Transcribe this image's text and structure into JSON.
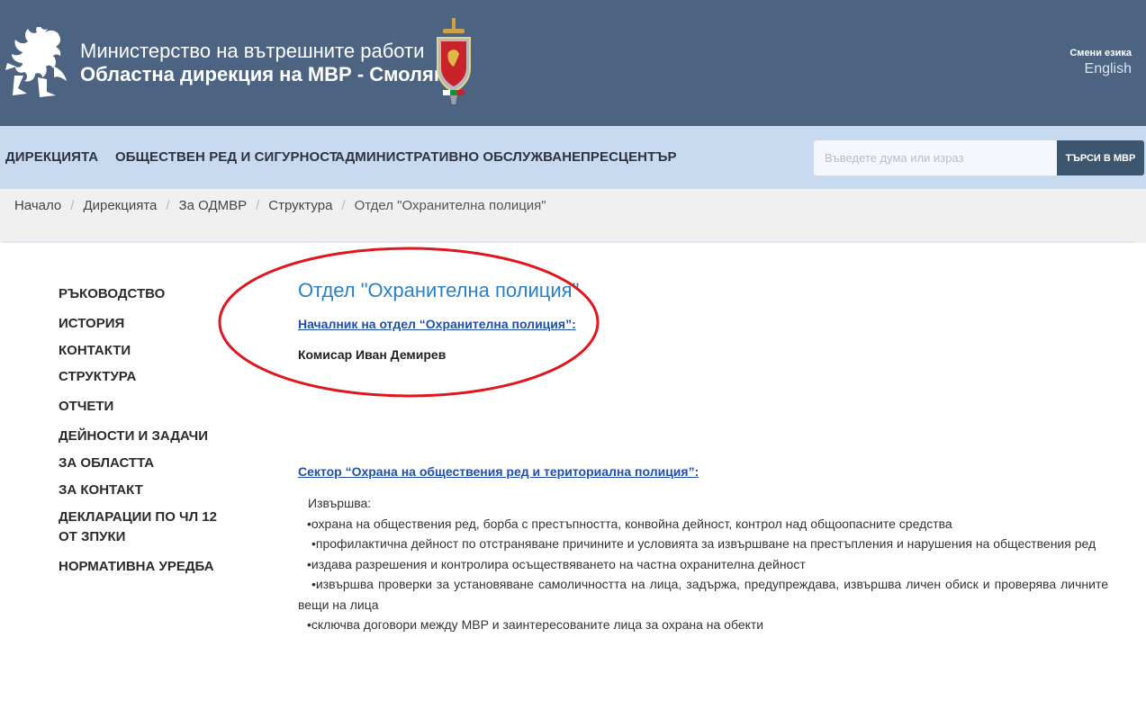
{
  "header": {
    "ministry": "Министерство на вътрешните работи",
    "directorate": "Областна дирекция на МВР - Смолян",
    "lang_label": "Смени езика",
    "lang_link": "English"
  },
  "nav": {
    "items": [
      "ДИРЕКЦИЯТА",
      "ОБЩЕСТВЕН РЕД И СИГУРНОСТ",
      "АДМИНИСТРАТИВНО ОБСЛУЖВАНЕ",
      "ПРЕСЦЕНТЪР"
    ],
    "search_placeholder": "Въведете дума или израз",
    "search_button": "ТЪРСИ В МВР"
  },
  "breadcrumb": {
    "items": [
      "Начало",
      "Дирекцията",
      "За ОДМВР",
      "Структура"
    ],
    "current": "Отдел \"Охранителна полиция\""
  },
  "sidebar": {
    "items": [
      "РЪКОВОДСТВО",
      "ИСТОРИЯ",
      "КОНТАКТИ",
      "СТРУКТУРА",
      "ОТЧЕТИ",
      "ДЕЙНОСТИ И ЗАДАЧИ",
      "ЗА ОБЛАСТТА",
      "ЗА КОНТАКТ",
      "ДЕКЛАРАЦИИ ПО ЧЛ 12 ОТ ЗПУКИ",
      "НОРМАТИВНА УРЕДБА"
    ]
  },
  "main": {
    "title": "Отдел \"Охранителна полиция\"",
    "chief_heading": "Началник на отдел “Охранителна полиция”:",
    "chief_name": "Комисар Иван Демирев",
    "sector_heading": "Сектор “Охрана на обществения ред и териториална полиция”:",
    "duties_intro": "Извършва:",
    "duties": [
      "•охрана на обществения ред, борба с престъпността, конвойна дейност, контрол над общоопасните средства",
      "•профилактична дейност по отстраняване причините и условията за извършване на престъпления и нарушения на обществения ред",
      "•издава разрешения и контролира осъществяването на частна охранителна дейност",
      "•извършва проверки за установяване самоличността на лица, задържа, предупреждава, извършва личен обиск и проверява личните вещи на лица",
      "•сключва договори между МВР и заинтересованите лица за охрана на обекти"
    ]
  },
  "colors": {
    "header_bg": "#4c6482",
    "nav_bg": "#c7daf0",
    "title_blue": "#2a80c4",
    "link_blue": "#1f4fa8",
    "annotation_red": "#e0161e"
  },
  "icons": {
    "logo": "bulgarian-lion-icon",
    "emblem": "police-shield-sword-icon"
  }
}
